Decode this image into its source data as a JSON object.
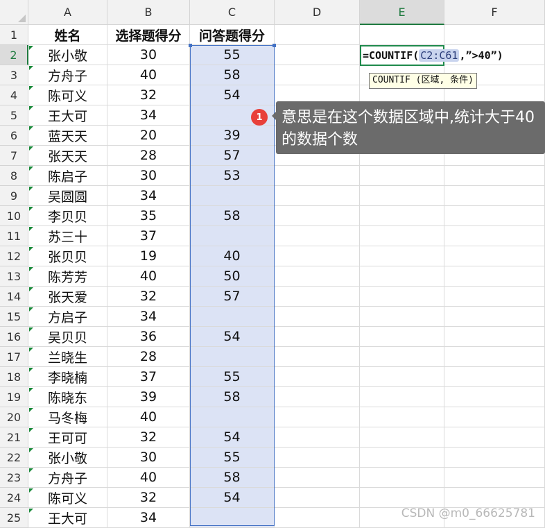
{
  "columns": [
    "A",
    "B",
    "C",
    "D",
    "E",
    "F"
  ],
  "active_column": "E",
  "active_row": 2,
  "header_row": {
    "A": "姓名",
    "B": "选择题得分",
    "C": "问答题得分"
  },
  "rows": [
    {
      "row": 2,
      "name": "张小敬",
      "b": "30",
      "c": "55"
    },
    {
      "row": 3,
      "name": "方舟子",
      "b": "40",
      "c": "58"
    },
    {
      "row": 4,
      "name": "陈可义",
      "b": "32",
      "c": "54"
    },
    {
      "row": 5,
      "name": "王大可",
      "b": "34",
      "c": ""
    },
    {
      "row": 6,
      "name": "蓝天天",
      "b": "20",
      "c": "39"
    },
    {
      "row": 7,
      "name": "张天天",
      "b": "28",
      "c": "57"
    },
    {
      "row": 8,
      "name": "陈启子",
      "b": "30",
      "c": "53"
    },
    {
      "row": 9,
      "name": "吴圆圆",
      "b": "34",
      "c": ""
    },
    {
      "row": 10,
      "name": "李贝贝",
      "b": "35",
      "c": "58"
    },
    {
      "row": 11,
      "name": "苏三十",
      "b": "37",
      "c": ""
    },
    {
      "row": 12,
      "name": "张贝贝",
      "b": "19",
      "c": "40"
    },
    {
      "row": 13,
      "name": "陈芳芳",
      "b": "40",
      "c": "50"
    },
    {
      "row": 14,
      "name": "张天爱",
      "b": "32",
      "c": "57"
    },
    {
      "row": 15,
      "name": "方启子",
      "b": "34",
      "c": ""
    },
    {
      "row": 16,
      "name": "吴贝贝",
      "b": "36",
      "c": "54"
    },
    {
      "row": 17,
      "name": "兰晓生",
      "b": "28",
      "c": ""
    },
    {
      "row": 18,
      "name": "李晓楠",
      "b": "37",
      "c": "55"
    },
    {
      "row": 19,
      "name": "陈晓东",
      "b": "39",
      "c": "58"
    },
    {
      "row": 20,
      "name": "马冬梅",
      "b": "40",
      "c": ""
    },
    {
      "row": 21,
      "name": "王可可",
      "b": "32",
      "c": "54"
    },
    {
      "row": 22,
      "name": "张小敬",
      "b": "30",
      "c": "55"
    },
    {
      "row": 23,
      "name": "方舟子",
      "b": "40",
      "c": "58"
    },
    {
      "row": 24,
      "name": "陈可义",
      "b": "32",
      "c": "54"
    },
    {
      "row": 25,
      "name": "王大可",
      "b": "34",
      "c": ""
    }
  ],
  "formula": {
    "prefix": "=COUNTIF(",
    "ref": "C2:C61",
    "suffix": ",”>40”)"
  },
  "tooltip": "COUNTIF (区域, 条件)",
  "comment": {
    "badge": "1",
    "text": "意思是在这个数据区域中,统计大于40的数据个数"
  },
  "watermark": "CSDN @m0_66625781",
  "colors": {
    "selection": "#dce3f5",
    "range_border": "#4472c4",
    "active_border": "#1f8a4c",
    "comment_bg": "#6b6b6b",
    "badge": "#e8403a"
  }
}
